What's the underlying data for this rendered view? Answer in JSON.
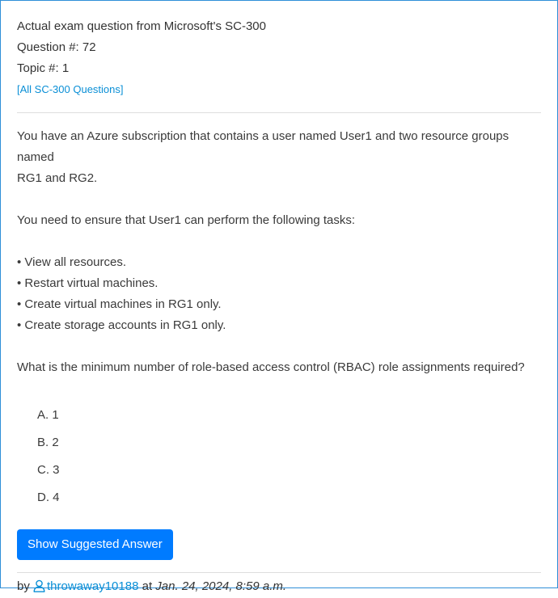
{
  "header": {
    "exam_line": "Actual exam question from Microsoft's SC-300",
    "question_number": "Question #: 72",
    "topic_number": "Topic #: 1",
    "all_questions_link": "[All SC-300 Questions]"
  },
  "question": {
    "intro_line1": "You have an Azure subscription that contains a user named User1 and two resource groups named",
    "intro_line2": "RG1 and RG2.",
    "requirement": "You need to ensure that User1 can perform the following tasks:",
    "tasks": [
      "• View all resources.",
      "• Restart virtual machines.",
      "• Create virtual machines in RG1 only.",
      "• Create storage accounts in RG1 only."
    ],
    "prompt": "What is the minimum number of role-based access control (RBAC) role assignments required?"
  },
  "choices": [
    "A. 1",
    "B. 2",
    "C. 3",
    "D. 4"
  ],
  "answer_button": "Show Suggested Answer",
  "footer": {
    "by": "by",
    "username": "throwaway10188",
    "at": "at",
    "date": "Jan. 24, 2024, 8:59 a.m."
  },
  "colors": {
    "link": "#0a8fd6",
    "button": "#007bff",
    "border": "#2f8fd8"
  },
  "icons": {
    "user": "user-outline-icon"
  }
}
